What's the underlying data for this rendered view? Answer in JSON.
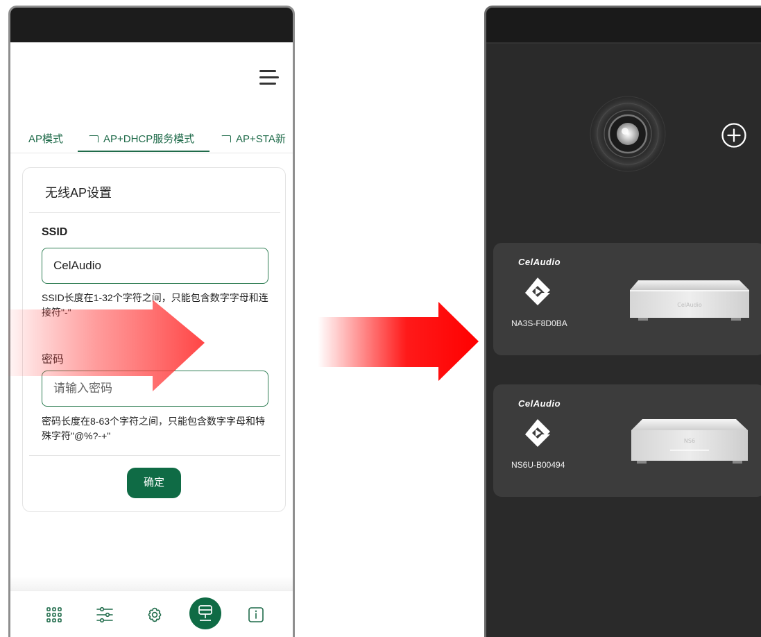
{
  "left_phone": {
    "tabs": [
      {
        "label": "AP模式",
        "active": false
      },
      {
        "label": "AP+DHCP服务模式",
        "active": true
      },
      {
        "label": "AP+STA新",
        "active": false
      }
    ],
    "card": {
      "title": "无线AP设置",
      "ssid_label": "SSID",
      "ssid_value": "CelAudio",
      "ssid_hint": "SSID长度在1-32个字符之间，只能包含数字字母和连接符\"-\"",
      "password_label": "密码",
      "password_placeholder": "请输入密码",
      "password_hint": "密码长度在8-63个字符之间，只能包含数字字母和特殊字符\"@%?-+\"",
      "confirm_label": "确定"
    },
    "bottom_nav": [
      "grid-icon",
      "sliders-icon",
      "gear-icon",
      "network-icon",
      "info-icon"
    ],
    "active_nav": "network-icon"
  },
  "right_phone": {
    "devices": [
      {
        "brand": "CelAudio",
        "name": "NA3S-F8D0BA",
        "front_text": "CelAudio"
      },
      {
        "brand": "CelAudio",
        "name": "NS6U-B00494",
        "front_text": "NS6"
      }
    ]
  },
  "colors": {
    "accent": "#0f6b45",
    "arrow": "#ff0000",
    "dark_bg": "#2a2a2a",
    "card_bg": "#3c3c3c"
  }
}
